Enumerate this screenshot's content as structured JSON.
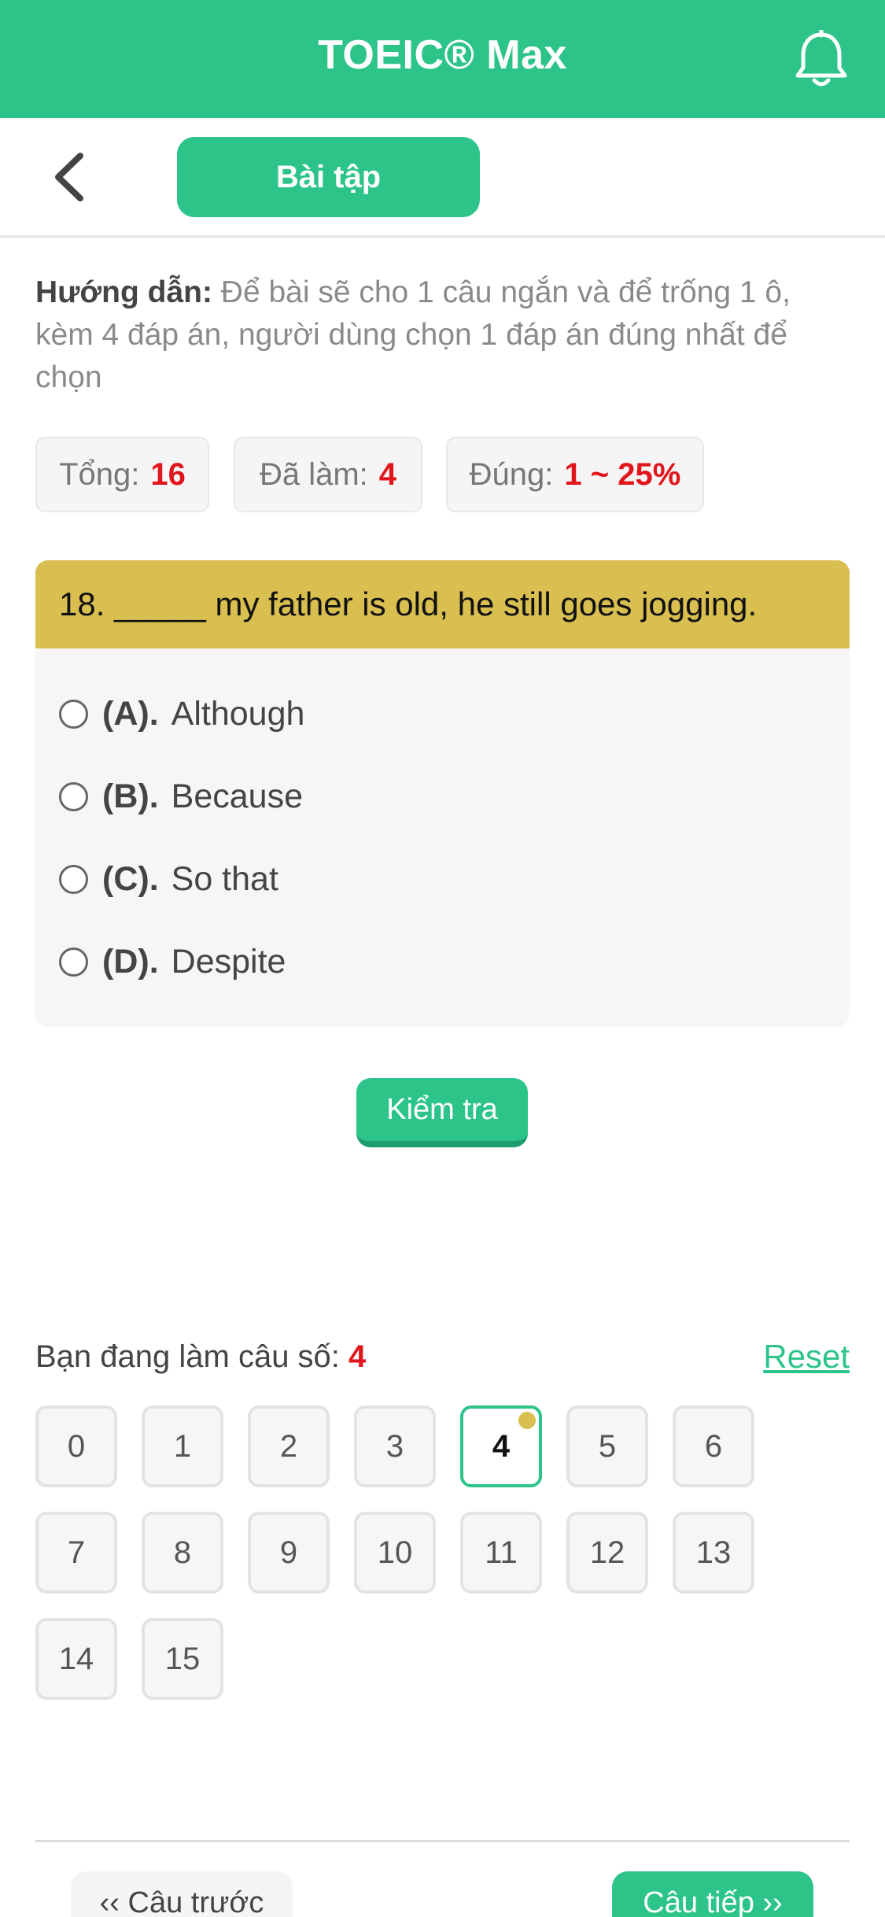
{
  "header": {
    "title": "TOEIC® Max",
    "bell_icon": "bell-icon",
    "color": "#2dc489"
  },
  "subbar": {
    "back_icon": "chevron-left-icon",
    "tab_label": "Bài tập"
  },
  "guide": {
    "label": "Hướng dẫn:",
    "text": " Để bài sẽ cho 1 câu ngắn và để trống 1 ô, kèm 4 đáp án, người dùng chọn 1 đáp án đúng nhất để chọn"
  },
  "stats": {
    "total_label": "Tổng:",
    "total_value": "16",
    "done_label": "Đã làm:",
    "done_value": "4",
    "correct_label": "Đúng:",
    "correct_value": "1 ~ 25%"
  },
  "question": {
    "text": "18. _____ my father is old, he still goes jogging.",
    "options": [
      {
        "letter": "(A).",
        "text": "Although"
      },
      {
        "letter": "(B).",
        "text": "Because"
      },
      {
        "letter": "(C).",
        "text": "So that"
      },
      {
        "letter": "(D).",
        "text": "Despite"
      }
    ]
  },
  "check_button": "Kiểm tra",
  "progress": {
    "label": "Bạn đang làm câu số:",
    "current": "4",
    "reset_label": "Reset",
    "numbers": [
      "0",
      "1",
      "2",
      "3",
      "4",
      "5",
      "6",
      "7",
      "8",
      "9",
      "10",
      "11",
      "12",
      "13",
      "14",
      "15"
    ],
    "active_index": 4
  },
  "nav": {
    "prev": "‹‹ Câu trước",
    "next": "Câu tiếp ››"
  }
}
